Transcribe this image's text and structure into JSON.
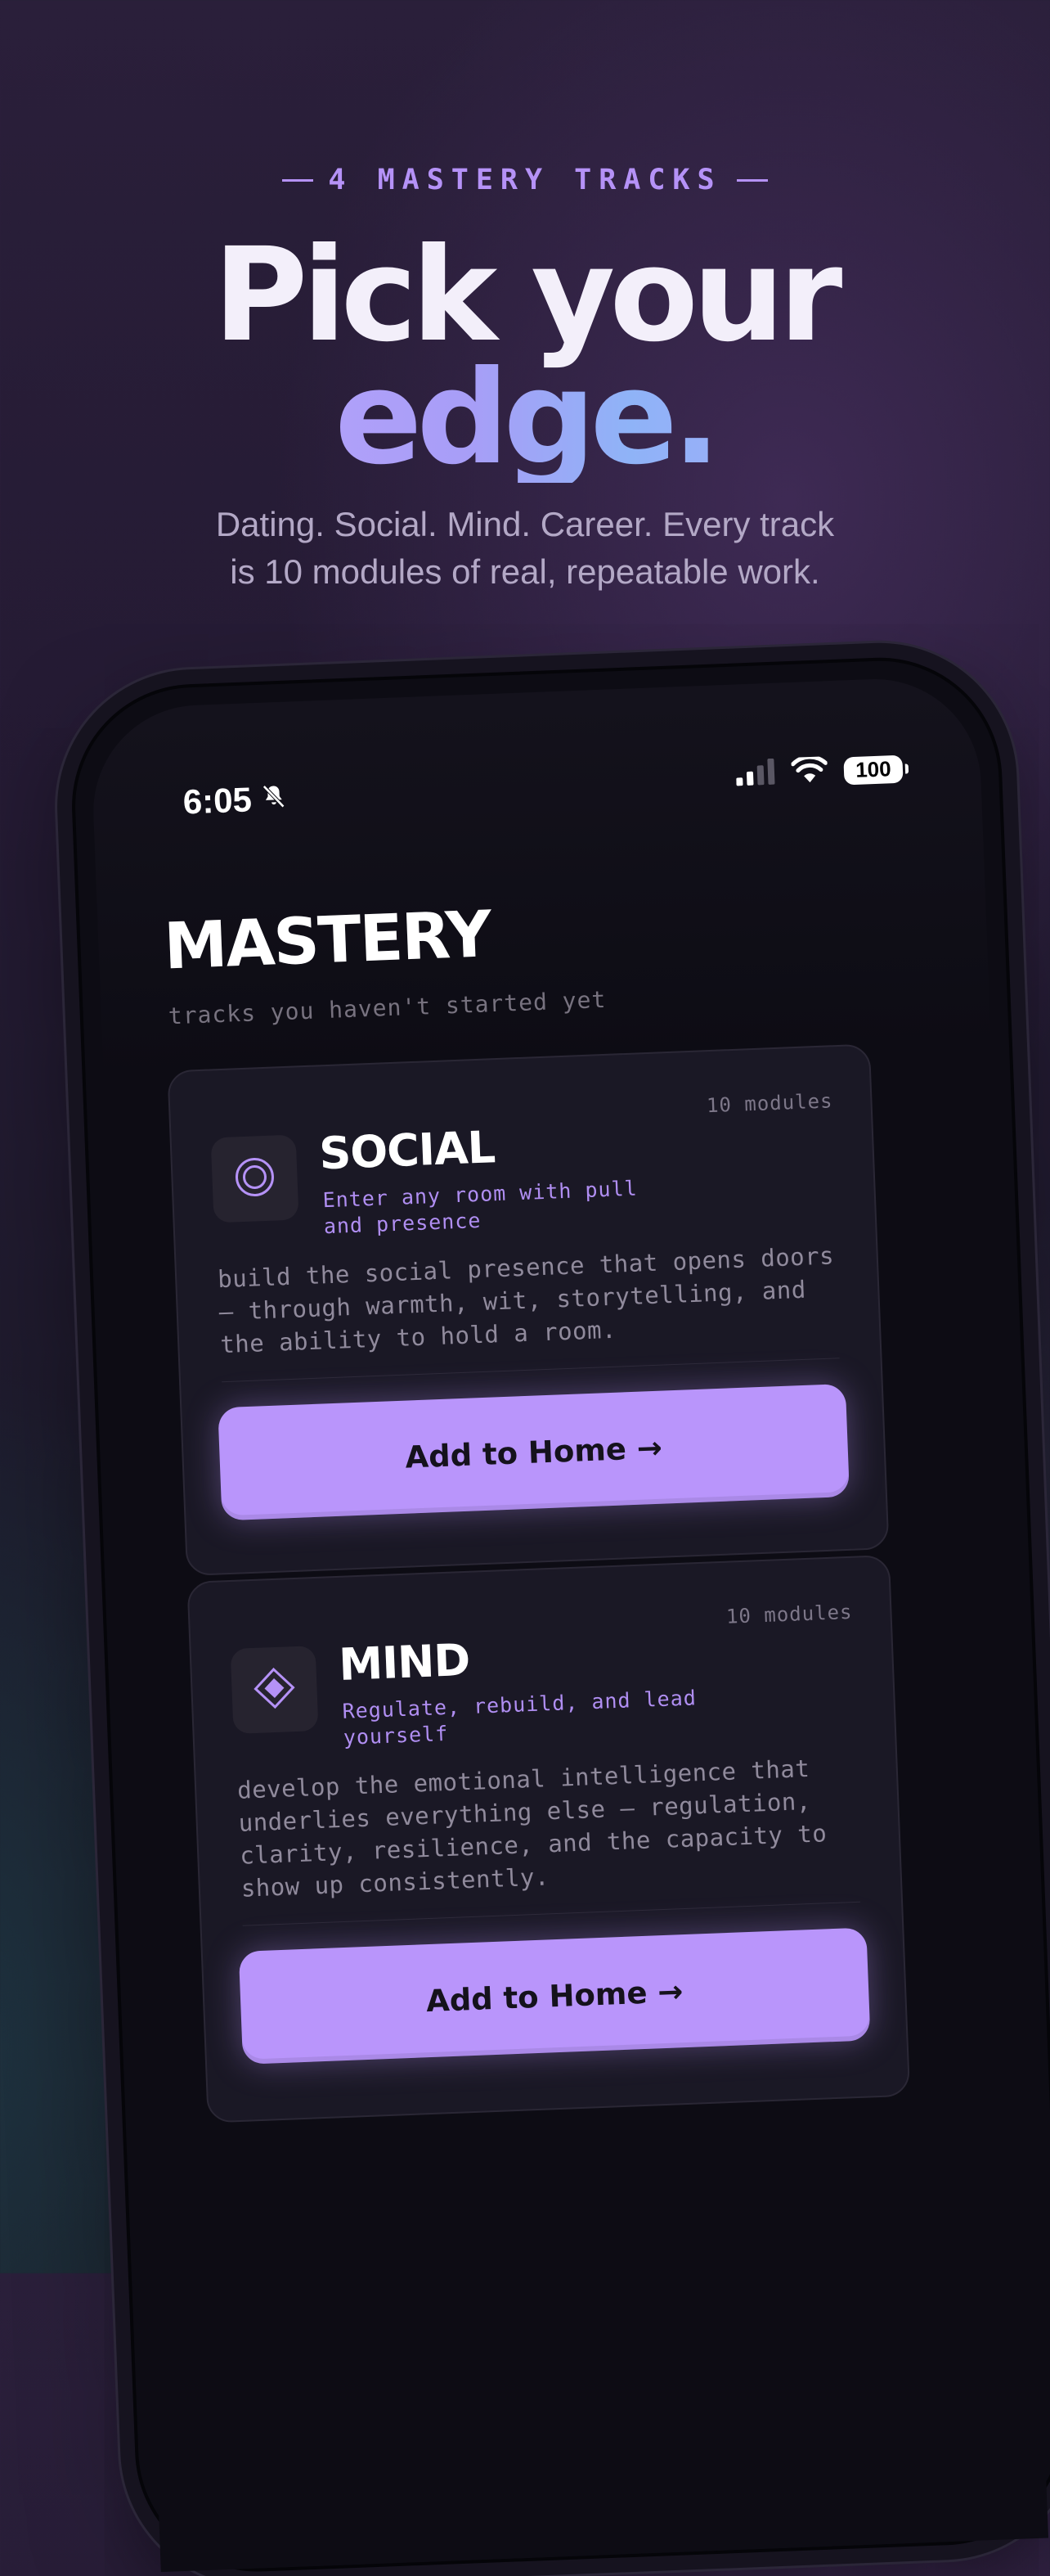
{
  "hero": {
    "eyebrow": "4 MASTERY TRACKS",
    "title_line1": "Pick your",
    "title_line2": "edge.",
    "subtitle_line1": "Dating. Social. Mind. Career. Every track",
    "subtitle_line2": "is 10 modules of real, repeatable work."
  },
  "status_bar": {
    "time": "6:05",
    "battery": "100",
    "icons": [
      "bell-slash-icon",
      "cellular-signal-icon",
      "wifi-icon",
      "battery-icon"
    ]
  },
  "screen": {
    "title": "MASTERY",
    "subtitle": "tracks you haven't started yet"
  },
  "cards": [
    {
      "name": "SOCIAL",
      "icon": "concentric-circles-icon",
      "modules": "10 modules",
      "tagline": "Enter any room with pull and presence",
      "description": "build the social presence that opens doors — through warmth, wit, storytelling, and the ability to hold a room.",
      "button": "Add to Home →"
    },
    {
      "name": "MIND",
      "icon": "diamond-icon",
      "modules": "10 modules",
      "tagline": "Regulate, rebuild, and lead yourself",
      "description": "develop the emotional intelligence that underlies everything else — regulation, clarity, resilience, and the capacity to show up consistently.",
      "button": "Add to Home →"
    }
  ],
  "colors": {
    "accent": "#b995fb",
    "card_bg": "#1a1825",
    "screen_bg": "#0d0c14"
  }
}
